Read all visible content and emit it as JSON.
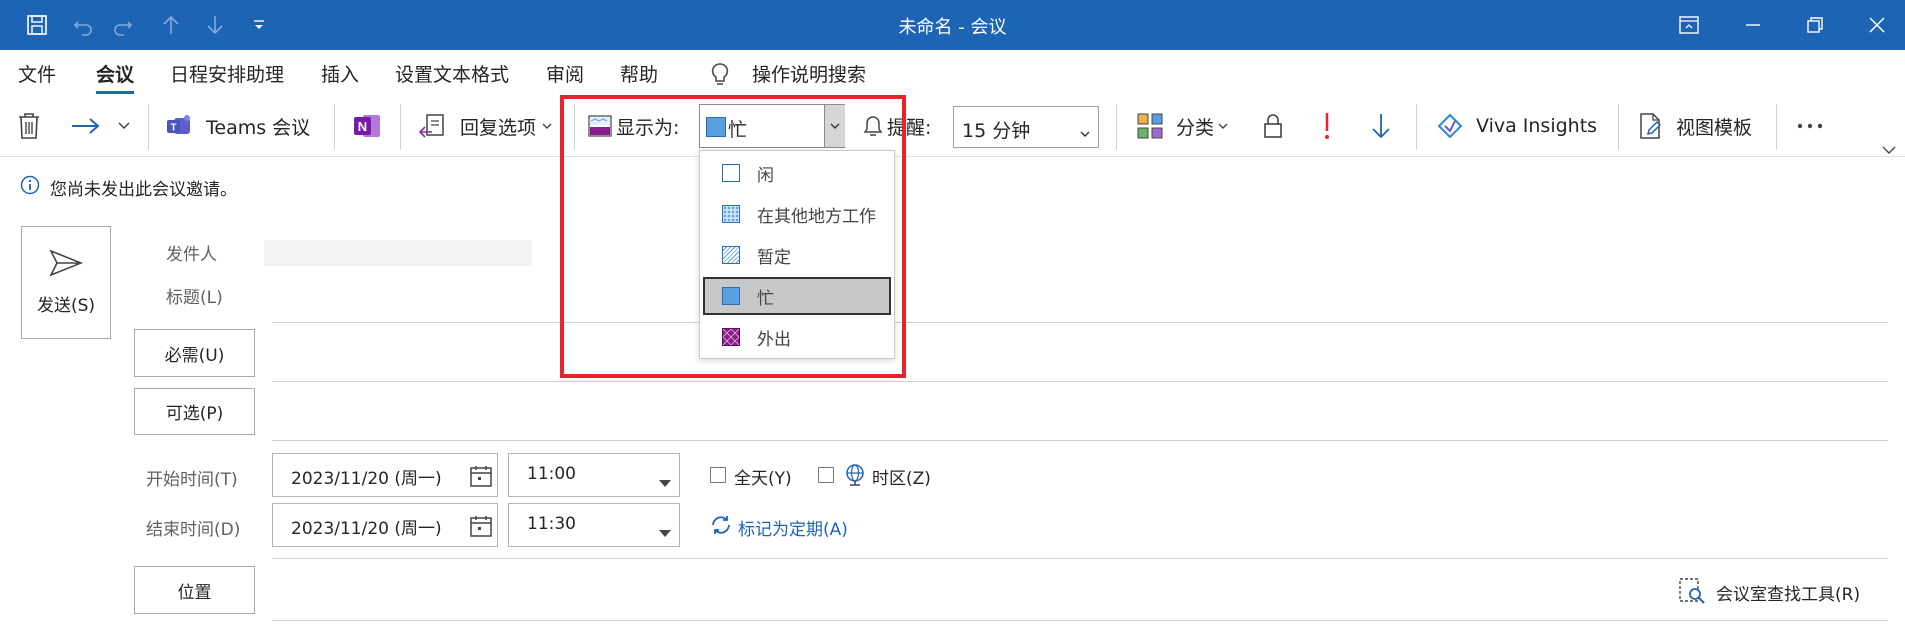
{
  "window": {
    "title": "未命名  -  会议"
  },
  "tabs": [
    "文件",
    "会议",
    "日程安排助理",
    "插入",
    "设置文本格式",
    "审阅",
    "帮助"
  ],
  "tell_me": "操作说明搜索",
  "ribbon": {
    "teams": "Teams 会议",
    "reply_options": "回复选项",
    "show_as_label": "显示为:",
    "show_as_value": "忙",
    "reminder_label": "提醒:",
    "reminder_value": "15 分钟",
    "categorize": "分类",
    "viva": "Viva Insights",
    "view_templates": "视图模板"
  },
  "show_as_menu": {
    "items": [
      {
        "label": "闲",
        "swatch": "free"
      },
      {
        "label": "在其他地方工作",
        "swatch": "elsewhere"
      },
      {
        "label": "暂定",
        "swatch": "tentative"
      },
      {
        "label": "忙",
        "swatch": "busy",
        "selected": true
      },
      {
        "label": "外出",
        "swatch": "oof"
      }
    ]
  },
  "info_bar": "您尚未发出此会议邀请。",
  "form": {
    "send": "发送(S)",
    "from_label": "发件人",
    "subject_label": "标题(L)",
    "required_btn": "必需(U)",
    "optional_btn": "可选(P)",
    "start_label": "开始时间(T)",
    "end_label": "结束时间(D)",
    "start_date": "2023/11/20 (周一)",
    "start_time": "11:00",
    "end_date": "2023/11/20 (周一)",
    "end_time": "11:30",
    "all_day": "全天(Y)",
    "time_zone": "时区(Z)",
    "recurrence": "标记为定期(A)",
    "location_btn": "位置",
    "room_finder": "会议室查找工具(R)"
  },
  "colors": {
    "titlebar": "#1e64b5",
    "highlight": "#e8232e",
    "busy": "#5aa0e0",
    "oof": "#8b1c8b"
  }
}
